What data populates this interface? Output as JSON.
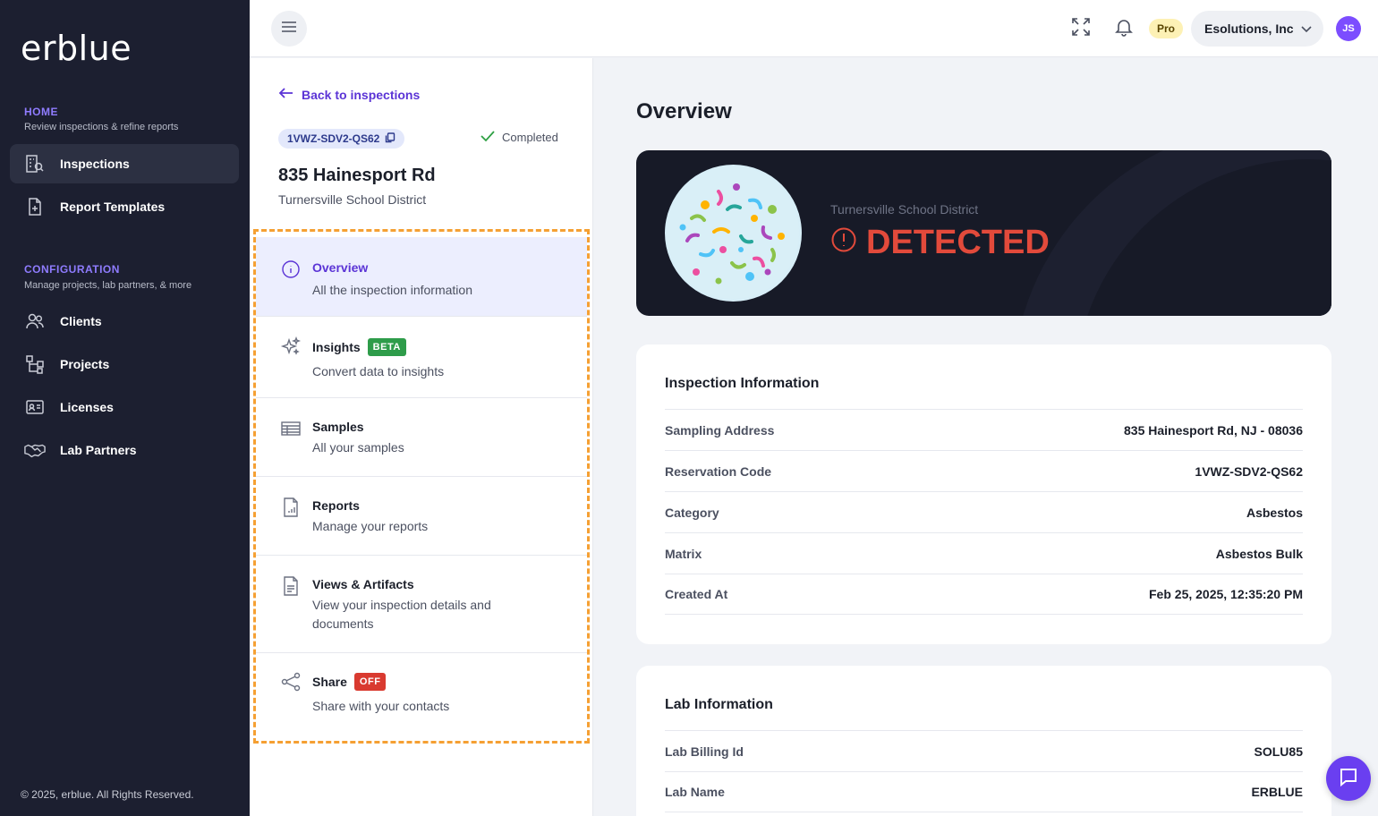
{
  "sidebar": {
    "logo": "erblue",
    "home_title": "HOME",
    "home_sub": "Review inspections & refine reports",
    "home_items": [
      {
        "label": "Inspections",
        "icon": "building-search-icon"
      },
      {
        "label": "Report Templates",
        "icon": "file-plus-icon"
      }
    ],
    "config_title": "CONFIGURATION",
    "config_sub": "Manage projects, lab partners, & more",
    "config_items": [
      {
        "label": "Clients",
        "icon": "users-icon"
      },
      {
        "label": "Projects",
        "icon": "hierarchy-icon"
      },
      {
        "label": "Licenses",
        "icon": "id-card-icon"
      },
      {
        "label": "Lab Partners",
        "icon": "handshake-icon"
      }
    ],
    "footer": "© 2025, erblue. All Rights Reserved."
  },
  "topbar": {
    "plan": "Pro",
    "org": "Esolutions, Inc",
    "avatar": "JS"
  },
  "inspection": {
    "back_label": "Back to inspections",
    "code": "1VWZ-SDV2-QS62",
    "status": "Completed",
    "address": "835 Hainesport Rd",
    "district": "Turnersville School District",
    "menu": [
      {
        "title": "Overview",
        "subtitle": "All the inspection information",
        "icon": "info-icon"
      },
      {
        "title": "Insights",
        "tag": "BETA",
        "subtitle": "Convert data to insights",
        "icon": "sparkle-icon"
      },
      {
        "title": "Samples",
        "subtitle": "All your samples",
        "icon": "table-icon"
      },
      {
        "title": "Reports",
        "subtitle": "Manage your reports",
        "icon": "report-file-icon"
      },
      {
        "title": "Views & Artifacts",
        "subtitle": "View your inspection details and documents",
        "icon": "document-icon"
      },
      {
        "title": "Share",
        "tag": "OFF",
        "subtitle": "Share with your contacts",
        "icon": "share-icon"
      }
    ]
  },
  "overview": {
    "title": "Overview",
    "hero_district": "Turnersville School District",
    "hero_status": "DETECTED",
    "inspection_info": {
      "title": "Inspection Information",
      "rows": [
        {
          "label": "Sampling Address",
          "value": "835 Hainesport Rd, NJ - 08036"
        },
        {
          "label": "Reservation Code",
          "value": "1VWZ-SDV2-QS62"
        },
        {
          "label": "Category",
          "value": "Asbestos"
        },
        {
          "label": "Matrix",
          "value": "Asbestos Bulk"
        },
        {
          "label": "Created At",
          "value": "Feb 25, 2025, 12:35:20 PM"
        }
      ]
    },
    "lab_info": {
      "title": "Lab Information",
      "rows": [
        {
          "label": "Lab Billing Id",
          "value": "SOLU85"
        },
        {
          "label": "Lab Name",
          "value": "ERBLUE"
        }
      ]
    }
  },
  "colors": {
    "accent": "#5b34d6",
    "sidebar_bg": "#1c1f30",
    "detected": "#e24a3b",
    "highlight_border": "#f5a033"
  }
}
